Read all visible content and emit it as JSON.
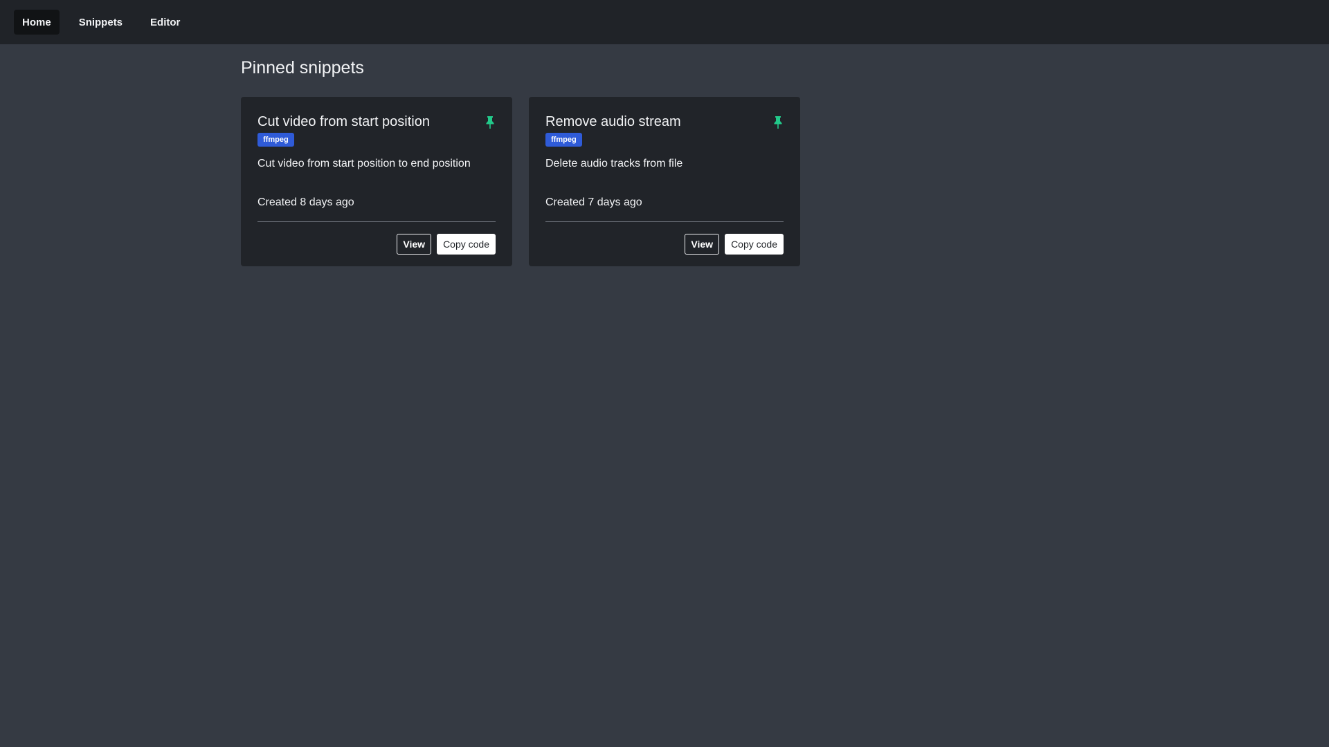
{
  "nav": {
    "items": [
      {
        "label": "Home",
        "active": true
      },
      {
        "label": "Snippets",
        "active": false
      },
      {
        "label": "Editor",
        "active": false
      }
    ]
  },
  "page": {
    "title": "Pinned snippets"
  },
  "cards": [
    {
      "title": "Cut video from start position",
      "tag": "ffmpeg",
      "description": "Cut video from start position to end position",
      "created": "Created 8 days ago",
      "pinned": true,
      "view_label": "View",
      "copy_label": "Copy code"
    },
    {
      "title": "Remove audio stream",
      "tag": "ffmpeg",
      "description": "Delete audio tracks from file",
      "created": "Created 7 days ago",
      "pinned": true,
      "view_label": "View",
      "copy_label": "Copy code"
    }
  ],
  "icons": {
    "pin": "pin-icon"
  },
  "colors": {
    "accent_pin": "#22c98a",
    "tag_background": "#2f5bd8",
    "navbar_background": "#202328",
    "page_background": "#353a43",
    "card_background": "#212429"
  }
}
